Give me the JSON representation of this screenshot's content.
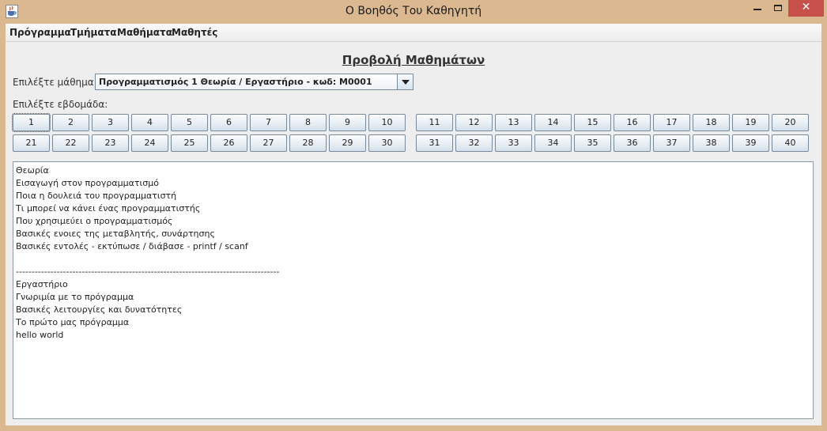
{
  "window": {
    "title": "Ο Βοηθός Του Καθηγητή",
    "close_glyph": "✕"
  },
  "menu": [
    "Πρόγραμμα",
    "Τμήματα",
    "Μαθήματα",
    "Μαθητές"
  ],
  "page_title": "Προβολή Μαθημάτων",
  "course_label": "Επιλέξτε μάθημα:",
  "course_select": {
    "value": "Προγραμματισμός 1 Θεωρία / Εργαστήριο - κωδ: Μ0001"
  },
  "week_label": "Επιλέξτε εβδομάδα:",
  "weeks": [
    "1",
    "2",
    "3",
    "4",
    "5",
    "6",
    "7",
    "8",
    "9",
    "10",
    "11",
    "12",
    "13",
    "14",
    "15",
    "16",
    "17",
    "18",
    "19",
    "20",
    "21",
    "22",
    "23",
    "24",
    "25",
    "26",
    "27",
    "28",
    "29",
    "30",
    "31",
    "32",
    "33",
    "34",
    "35",
    "36",
    "37",
    "38",
    "39",
    "40"
  ],
  "selected_week": "1",
  "content_lines": [
    "Θεωρία",
    "Εισαγωγή στον προγραμματισμό",
    "Ποια η δουλειά του προγραμματιστή",
    "Τι μπορεί να κάνει ένας προγραμματιστής",
    "Που χρησιμεύει ο προγραμματισμός",
    "Βασικές ενοιες της μεταβλητής, συνάρτησης",
    "Βασικές εντολές - εκτύπωσε / διάβασε - printf / scanf",
    "",
    "------------------------------------------------------------------------------------",
    "Εργαστήριο",
    "Γνωριμία με το πρόγραμμα",
    "Βασικές λειτουργίες και δυνατότητες",
    "Το πρώτο μας πρόγραμμα",
    "hello world"
  ],
  "colors": {
    "titlebar": "#dcb891",
    "close": "#c7504a",
    "panel": "#eeeeee"
  }
}
